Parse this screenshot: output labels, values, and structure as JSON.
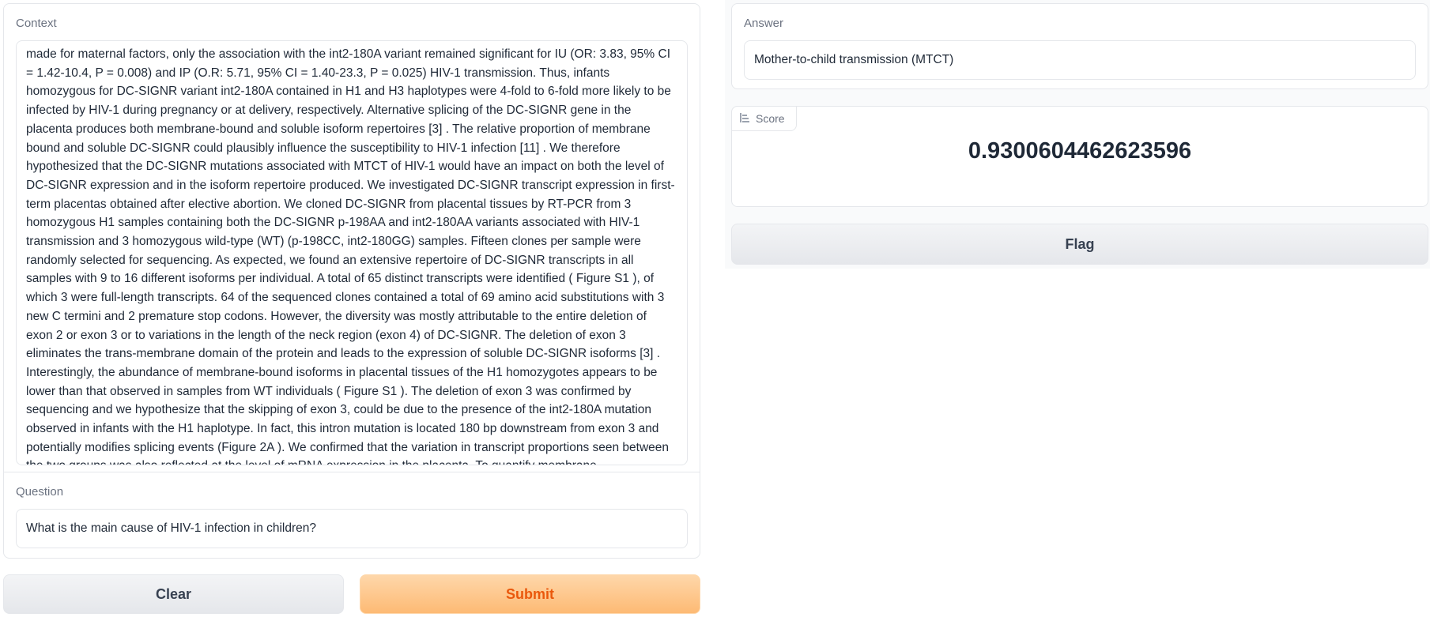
{
  "context": {
    "label": "Context",
    "text": "made for maternal factors, only the association with the int2-180A variant remained significant for IU (OR: 3.83, 95% CI = 1.42-10.4, P = 0.008) and IP (O.R: 5.71, 95% CI = 1.40-23.3, P = 0.025) HIV-1 transmission. Thus, infants homozygous for DC-SIGNR variant int2-180A contained in H1 and H3 haplotypes were 4-fold to 6-fold more likely to be infected by HIV-1 during pregnancy or at delivery, respectively. Alternative splicing of the DC-SIGNR gene in the placenta produces both membrane-bound and soluble isoform repertoires [3] . The relative proportion of membrane bound and soluble DC-SIGNR could plausibly influence the susceptibility to HIV-1 infection [11] . We therefore hypothesized that the DC-SIGNR mutations associated with MTCT of HIV-1 would have an impact on both the level of DC-SIGNR expression and in the isoform repertoire produced. We investigated DC-SIGNR transcript expression in first-term placentas obtained after elective abortion. We cloned DC-SIGNR from placental tissues by RT-PCR from 3 homozygous H1 samples containing both the DC-SIGNR p-198AA and int2-180AA variants associated with HIV-1 transmission and 3 homozygous wild-type (WT) (p-198CC, int2-180GG) samples. Fifteen clones per sample were randomly selected for sequencing. As expected, we found an extensive repertoire of DC-SIGNR transcripts in all samples with 9 to 16 different isoforms per individual. A total of 65 distinct transcripts were identified ( Figure S1 ), of which 3 were full-length transcripts. 64 of the sequenced clones contained a total of 69 amino acid substitutions with 3 new C termini and 2 premature stop codons. However, the diversity was mostly attributable to the entire deletion of exon 2 or exon 3 or to variations in the length of the neck region (exon 4) of DC-SIGNR. The deletion of exon 3 eliminates the trans-membrane domain of the protein and leads to the expression of soluble DC-SIGNR isoforms [3] . Interestingly, the abundance of membrane-bound isoforms in placental tissues of the H1 homozygotes appears to be lower than that observed in samples from WT individuals ( Figure S1 ). The deletion of exon 3 was confirmed by sequencing and we hypothesize that the skipping of exon 3, could be due to the presence of the int2-180A mutation observed in infants with the H1 haplotype. In fact, this intron mutation is located 180 bp downstream from exon 3 and potentially modifies splicing events (Figure 2A ). We confirmed that the variation in transcript proportions seen between the two groups was also reflected at the level of mRNA expression in the placenta. To quantify membrane"
  },
  "question": {
    "label": "Question",
    "value": "What is the main cause of HIV-1 infection in children?"
  },
  "buttons": {
    "clear": "Clear",
    "submit": "Submit",
    "flag": "Flag"
  },
  "answer": {
    "label": "Answer",
    "value": "Mother-to-child transmission (MTCT)"
  },
  "score": {
    "label": "Score",
    "icon": "label-icon",
    "value": "0.9300604462623596"
  },
  "colors": {
    "submit_bg": "#fdba74",
    "submit_text": "#ea580c",
    "border": "#e5e7eb"
  }
}
